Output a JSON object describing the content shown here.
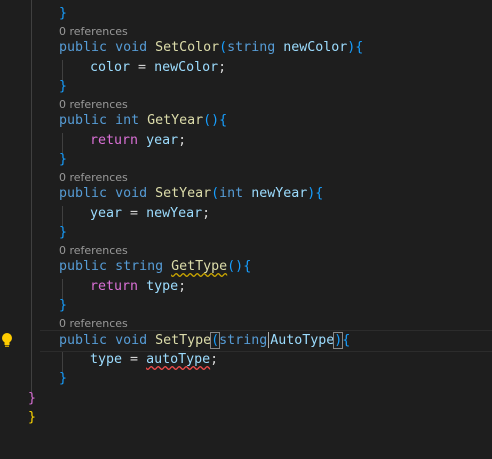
{
  "code": {
    "references": "0 references",
    "close_brace": "}",
    "setcolor": {
      "kw_public": "public",
      "kw_void": "void",
      "name": "SetColor",
      "open_paren": "(",
      "kw_string": "string",
      "param": "newColor",
      "close_paren": ")",
      "open_brace": "{",
      "body_target": "color",
      "body_op": " = ",
      "body_value": "newColor",
      "body_end": ";"
    },
    "getyear": {
      "kw_public": "public",
      "kw_int": "int",
      "name": "GetYear",
      "parens": "()",
      "open_brace": "{",
      "kw_return": "return",
      "body_value": "year",
      "body_end": ";"
    },
    "setyear": {
      "kw_public": "public",
      "kw_void": "void",
      "name": "SetYear",
      "open_paren": "(",
      "kw_int": "int",
      "param": "newYear",
      "close_paren": ")",
      "open_brace": "{",
      "body_target": "year",
      "body_op": " = ",
      "body_value": "newYear",
      "body_end": ";"
    },
    "gettype": {
      "kw_public": "public",
      "kw_string": "string",
      "name": "GetType",
      "parens": "()",
      "open_brace": "{",
      "kw_return": "return",
      "body_value": "type",
      "body_end": ";"
    },
    "settype": {
      "kw_public": "public",
      "kw_void": "void",
      "name": "SetType",
      "open_paren": "(",
      "kw_string": "string",
      "param": "AutoType",
      "close_paren": ")",
      "open_brace": "{",
      "body_target": "type",
      "body_op": " = ",
      "body_value": "autoType",
      "body_end": ";"
    },
    "outer_close_1": "}",
    "outer_close_2": "}"
  },
  "icons": {
    "gutter": "lightbulb-icon"
  },
  "colors": {
    "background": "#1e1e1e",
    "keyword": "#569cd6",
    "function": "#dcdcaa",
    "variable": "#9cdcfe",
    "bracket_level1": "#ffd700",
    "bracket_level2": "#da70d6",
    "bracket_level3": "#179fff",
    "error_squiggle": "#f14c4c",
    "lightbulb": "#ffcc00"
  }
}
